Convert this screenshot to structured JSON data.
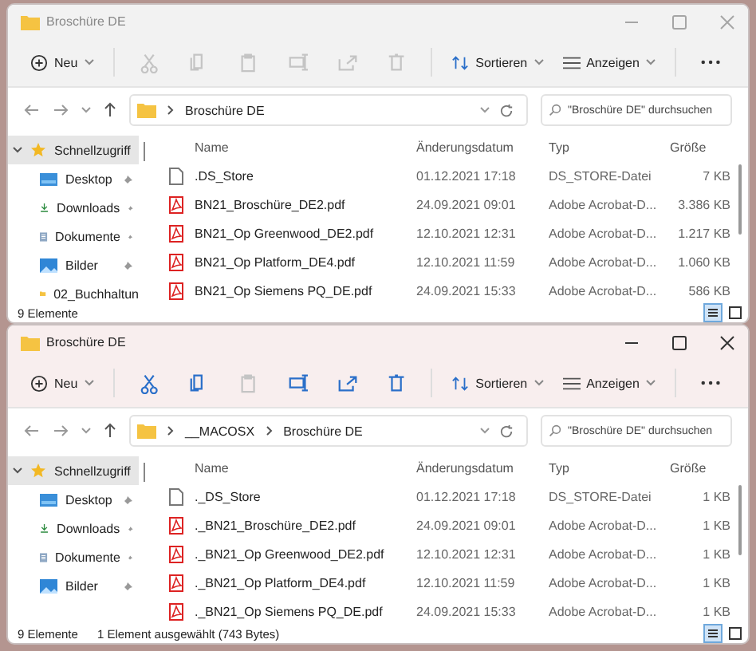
{
  "windows": [
    {
      "title": "Broschüre DE",
      "active": false,
      "new_label": "Neu",
      "sort_label": "Sortieren",
      "view_label": "Anzeigen",
      "tools": [
        {
          "kind": "cut",
          "disabled": true
        },
        {
          "kind": "copy",
          "disabled": true
        },
        {
          "kind": "paste",
          "disabled": true
        },
        {
          "kind": "rename",
          "disabled": true
        },
        {
          "kind": "share",
          "disabled": true
        },
        {
          "kind": "delete",
          "disabled": true
        }
      ],
      "path": [
        "Broschüre DE"
      ],
      "search_placeholder": "\"Broschüre DE\" durchsuchen",
      "columns": [
        "Name",
        "Änderungsdatum",
        "Typ",
        "Größe"
      ],
      "sidebar": [
        {
          "label": "Schnellzugriff",
          "kind": "star",
          "selected": true,
          "expanded": true,
          "pinned": false
        },
        {
          "label": "Desktop",
          "kind": "desktop",
          "selected": false,
          "pinned": true
        },
        {
          "label": "Downloads",
          "kind": "download",
          "selected": false,
          "pinned": true
        },
        {
          "label": "Dokumente",
          "kind": "document",
          "selected": false,
          "pinned": true
        },
        {
          "label": "Bilder",
          "kind": "pictures",
          "selected": false,
          "pinned": true
        },
        {
          "label": "02_Buchhaltun",
          "kind": "folder",
          "selected": false,
          "pinned": false
        }
      ],
      "rows": [
        {
          "kind": "file",
          "name": ".DS_Store",
          "date": "01.12.2021 17:18",
          "type": "DS_STORE-Datei",
          "size": "7 KB"
        },
        {
          "kind": "pdf",
          "name": "BN21_Broschüre_DE2.pdf",
          "date": "24.09.2021 09:01",
          "type": "Adobe Acrobat-D...",
          "size": "3.386 KB"
        },
        {
          "kind": "pdf",
          "name": "BN21_Op Greenwood_DE2.pdf",
          "date": "12.10.2021 12:31",
          "type": "Adobe Acrobat-D...",
          "size": "1.217 KB"
        },
        {
          "kind": "pdf",
          "name": "BN21_Op Platform_DE4.pdf",
          "date": "12.10.2021 11:59",
          "type": "Adobe Acrobat-D...",
          "size": "1.060 KB"
        },
        {
          "kind": "pdf",
          "name": "BN21_Op Siemens PQ_DE.pdf",
          "date": "24.09.2021 15:33",
          "type": "Adobe Acrobat-D...",
          "size": "586 KB"
        }
      ],
      "status": [
        "9 Elemente"
      ],
      "views": [
        {
          "kind": "details",
          "selected": true
        },
        {
          "kind": "tiles",
          "selected": false
        }
      ]
    },
    {
      "title": "Broschüre DE",
      "active": true,
      "new_label": "Neu",
      "sort_label": "Sortieren",
      "view_label": "Anzeigen",
      "tools": [
        {
          "kind": "cut",
          "disabled": false
        },
        {
          "kind": "copy",
          "disabled": false
        },
        {
          "kind": "paste",
          "disabled": true
        },
        {
          "kind": "rename",
          "disabled": false
        },
        {
          "kind": "share",
          "disabled": false
        },
        {
          "kind": "delete",
          "disabled": false
        }
      ],
      "path": [
        "__MACOSX",
        "Broschüre DE"
      ],
      "search_placeholder": "\"Broschüre DE\" durchsuchen",
      "columns": [
        "Name",
        "Änderungsdatum",
        "Typ",
        "Größe"
      ],
      "sidebar": [
        {
          "label": "Schnellzugriff",
          "kind": "star",
          "selected": true,
          "expanded": true,
          "pinned": false
        },
        {
          "label": "Desktop",
          "kind": "desktop",
          "selected": false,
          "pinned": true
        },
        {
          "label": "Downloads",
          "kind": "download",
          "selected": false,
          "pinned": true
        },
        {
          "label": "Dokumente",
          "kind": "document",
          "selected": false,
          "pinned": true
        },
        {
          "label": "Bilder",
          "kind": "pictures",
          "selected": false,
          "pinned": true
        }
      ],
      "rows": [
        {
          "kind": "file",
          "name": "._DS_Store",
          "date": "01.12.2021 17:18",
          "type": "DS_STORE-Datei",
          "size": "1 KB"
        },
        {
          "kind": "pdf",
          "name": "._BN21_Broschüre_DE2.pdf",
          "date": "24.09.2021 09:01",
          "type": "Adobe Acrobat-D...",
          "size": "1 KB"
        },
        {
          "kind": "pdf",
          "name": "._BN21_Op Greenwood_DE2.pdf",
          "date": "12.10.2021 12:31",
          "type": "Adobe Acrobat-D...",
          "size": "1 KB"
        },
        {
          "kind": "pdf",
          "name": "._BN21_Op Platform_DE4.pdf",
          "date": "12.10.2021 11:59",
          "type": "Adobe Acrobat-D...",
          "size": "1 KB"
        },
        {
          "kind": "pdf",
          "name": "._BN21_Op Siemens PQ_DE.pdf",
          "date": "24.09.2021 15:33",
          "type": "Adobe Acrobat-D...",
          "size": "1 KB"
        }
      ],
      "status": [
        "9 Elemente",
        "1 Element ausgewählt (743 Bytes)"
      ],
      "views": [
        {
          "kind": "details",
          "selected": true
        },
        {
          "kind": "tiles",
          "selected": false
        }
      ]
    }
  ]
}
